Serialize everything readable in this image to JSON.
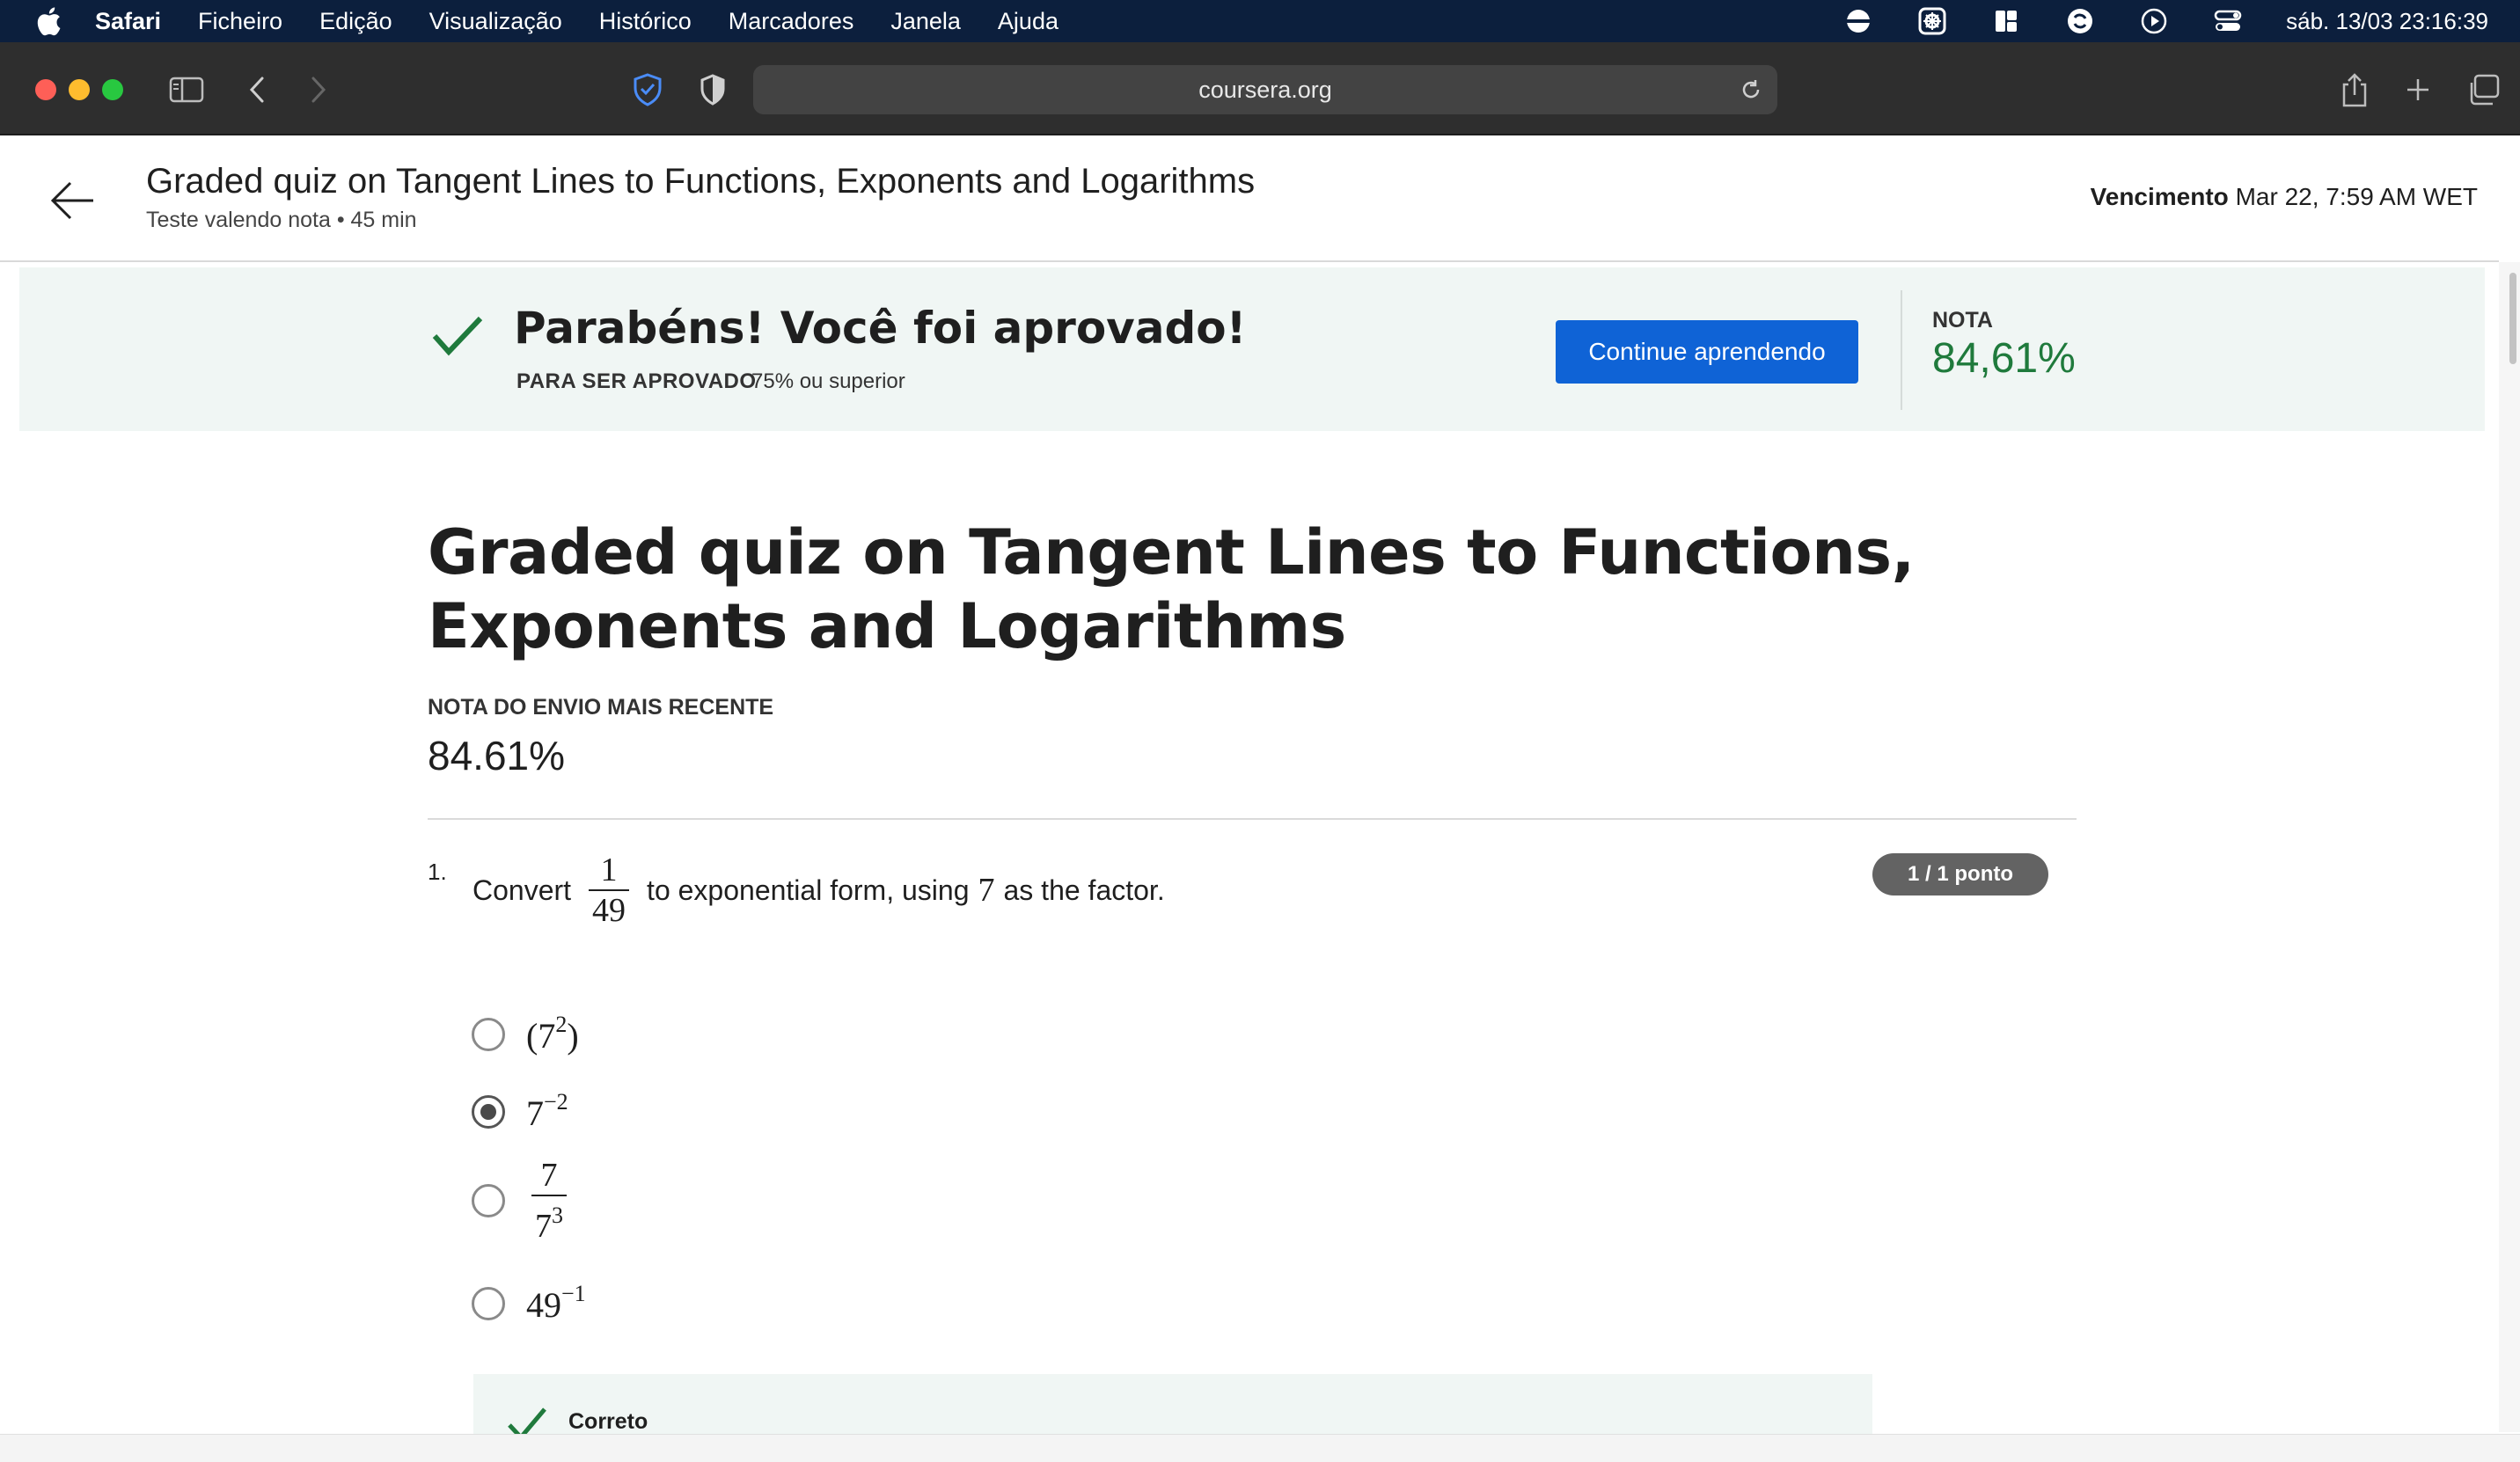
{
  "menubar": {
    "app_name": "Safari",
    "items": [
      "Ficheiro",
      "Edição",
      "Visualização",
      "Histórico",
      "Marcadores",
      "Janela",
      "Ajuda"
    ],
    "status_icons": [
      "vpn-icon",
      "app-icon",
      "layout-icon",
      "sync-icon",
      "play-icon",
      "control-center-icon"
    ],
    "clock": "sáb. 13/03  23:16:39"
  },
  "browser": {
    "url": "coursera.org"
  },
  "header": {
    "title": "Graded quiz on Tangent Lines to Functions, Exponents and Logarithms",
    "subtitle": "Teste valendo nota • 45 min",
    "due_label": "Vencimento",
    "due_value": "Mar 22, 7:59 AM WET"
  },
  "banner": {
    "congrats": "Parabéns! Você foi aprovado!",
    "pass_label": "PARA SER APROVADO",
    "pass_value": "75% ou superior",
    "continue_label": "Continue aprendendo",
    "grade_label": "NOTA",
    "grade_value": "84,61%",
    "colors": {
      "background": "#f0f6f4",
      "button": "#0f63d6",
      "grade": "#1f7a3c"
    }
  },
  "main": {
    "title": "Graded quiz on Tangent Lines to Functions, Exponents and Logarithms",
    "recent_label": "NOTA DO ENVIO MAIS RECENTE",
    "recent_value": "84.61%"
  },
  "question": {
    "number": "1.",
    "prefix": "Convert",
    "frac_num": "1",
    "frac_den": "49",
    "middle": "to exponential form, using",
    "factor": "7",
    "suffix": "as the factor.",
    "points": "1 / 1 ponto",
    "options": [
      {
        "base": "(7",
        "exp": "2",
        "tail": ")",
        "selected": false
      },
      {
        "base": "7",
        "exp": "−2",
        "tail": "",
        "selected": true
      },
      {
        "frac_num": "7",
        "frac_den_base": "7",
        "frac_den_exp": "3",
        "selected": false
      },
      {
        "base": "49",
        "exp": "−1",
        "tail": "",
        "selected": false
      }
    ],
    "feedback_label": "Correto"
  }
}
